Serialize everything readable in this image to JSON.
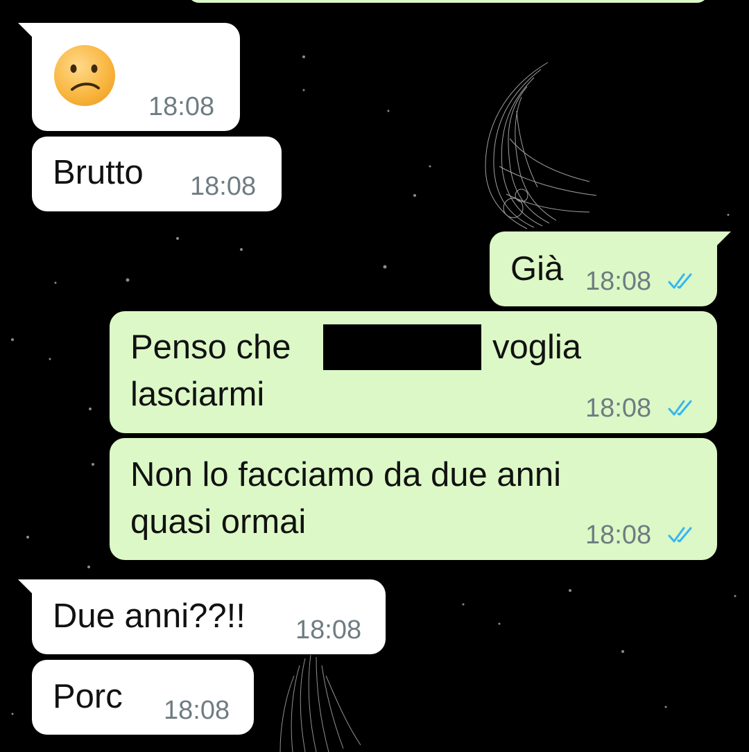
{
  "chat": {
    "messages": [
      {
        "id": "m1",
        "direction": "incoming",
        "emoji": "confused-face",
        "time": "18:08"
      },
      {
        "id": "m2",
        "direction": "incoming",
        "text": "Brutto",
        "time": "18:08"
      },
      {
        "id": "m3",
        "direction": "outgoing",
        "text": "Già",
        "time": "18:08",
        "status": "read"
      },
      {
        "id": "m4",
        "direction": "outgoing",
        "line1_before": "Penso che",
        "line1_after": "voglia",
        "line2": "lasciarmi",
        "redacted": true,
        "time": "18:08",
        "status": "read"
      },
      {
        "id": "m5",
        "direction": "outgoing",
        "line1": "Non lo facciamo da due anni",
        "line2": "quasi ormai",
        "time": "18:08",
        "status": "read"
      },
      {
        "id": "m6",
        "direction": "incoming",
        "text": "Due anni??!!",
        "time": "18:08"
      },
      {
        "id": "m7",
        "direction": "incoming",
        "text": "Porc",
        "time": "18:08"
      }
    ]
  },
  "colors": {
    "background": "#000000",
    "incoming_bubble": "#ffffff",
    "outgoing_bubble": "#dcf8c6",
    "timestamp": "#6f7c82",
    "read_ticks": "#34b7f1"
  }
}
